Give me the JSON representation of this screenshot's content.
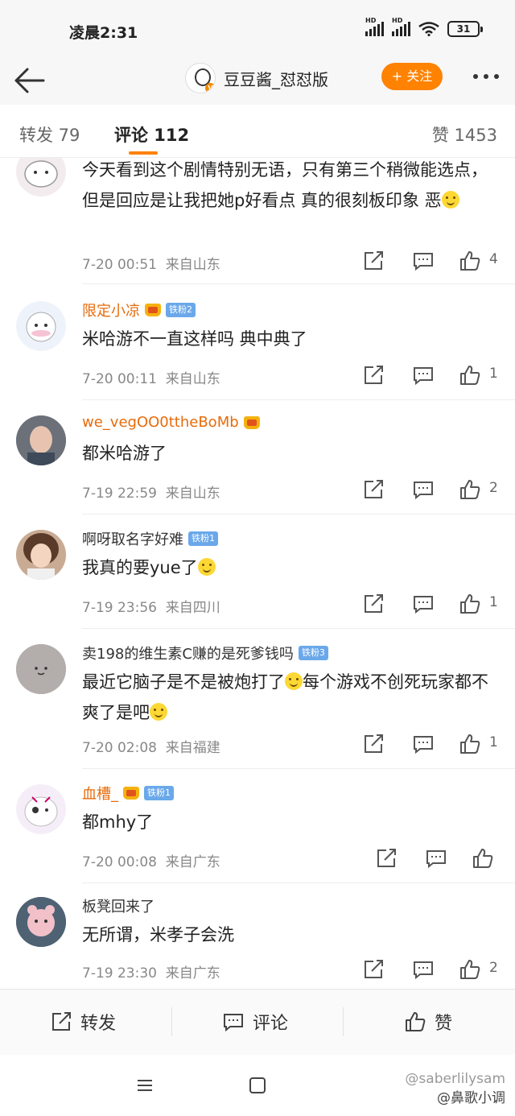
{
  "status_bar": {
    "time": "凌晨2:31",
    "signal_label_1": "HD",
    "signal_label_2": "HD",
    "battery": "31"
  },
  "header": {
    "back_icon": "arrow-left-icon",
    "account_name": "豆豆酱_怼怼版",
    "follow_label": "+ 关注",
    "more_icon": "more-dots-icon"
  },
  "tabs": {
    "repost": "转发 79",
    "comment": "评论 112",
    "like": "赞 1453",
    "accent_color": "#ff8200"
  },
  "comments": [
    {
      "name": "",
      "text": "今天看到这个剧情特别无语，只有第三个稍微能选点，但是回应是让我把她p好看点 真的很刻板印象 恶",
      "time": "7-20 00:51",
      "location": "来自山东",
      "likes": "4"
    },
    {
      "name": "限定小凉",
      "badge": "铁粉2",
      "text": "米哈游不一直这样吗 典中典了",
      "time": "7-20 00:11",
      "location": "来自山东",
      "likes": "1"
    },
    {
      "name": "we_vegOO0ttheBoMb",
      "text": "都米哈游了",
      "time": "7-19 22:59",
      "location": "来自山东",
      "likes": "2"
    },
    {
      "name": "啊呀取名字好难",
      "badge": "铁粉1",
      "text": "我真的要yue了",
      "time": "7-19 23:56",
      "location": "来自四川",
      "likes": "1"
    },
    {
      "name": "卖198的维生素C赚的是死爹钱吗",
      "badge": "铁粉3",
      "text": "最近它脑子是不是被炮打了",
      "text2": "每个游戏不创死玩家都不爽了是吧",
      "time": "7-20 02:08",
      "location": "来自福建",
      "likes": "1"
    },
    {
      "name": "血槽_",
      "badge": "铁粉1",
      "text": "都mhy了",
      "time": "7-20 00:08",
      "location": "来自广东",
      "likes": ""
    },
    {
      "name": "板凳回来了",
      "text": "无所谓，米孝子会洗",
      "time": "7-19 23:30",
      "location": "来自广东",
      "likes": "2"
    }
  ],
  "bottom_bar": {
    "repost": "转发",
    "comment": "评论",
    "like": "赞"
  },
  "watermark": {
    "handle": "@saberlilysam",
    "author": "@鼻歌小调"
  }
}
